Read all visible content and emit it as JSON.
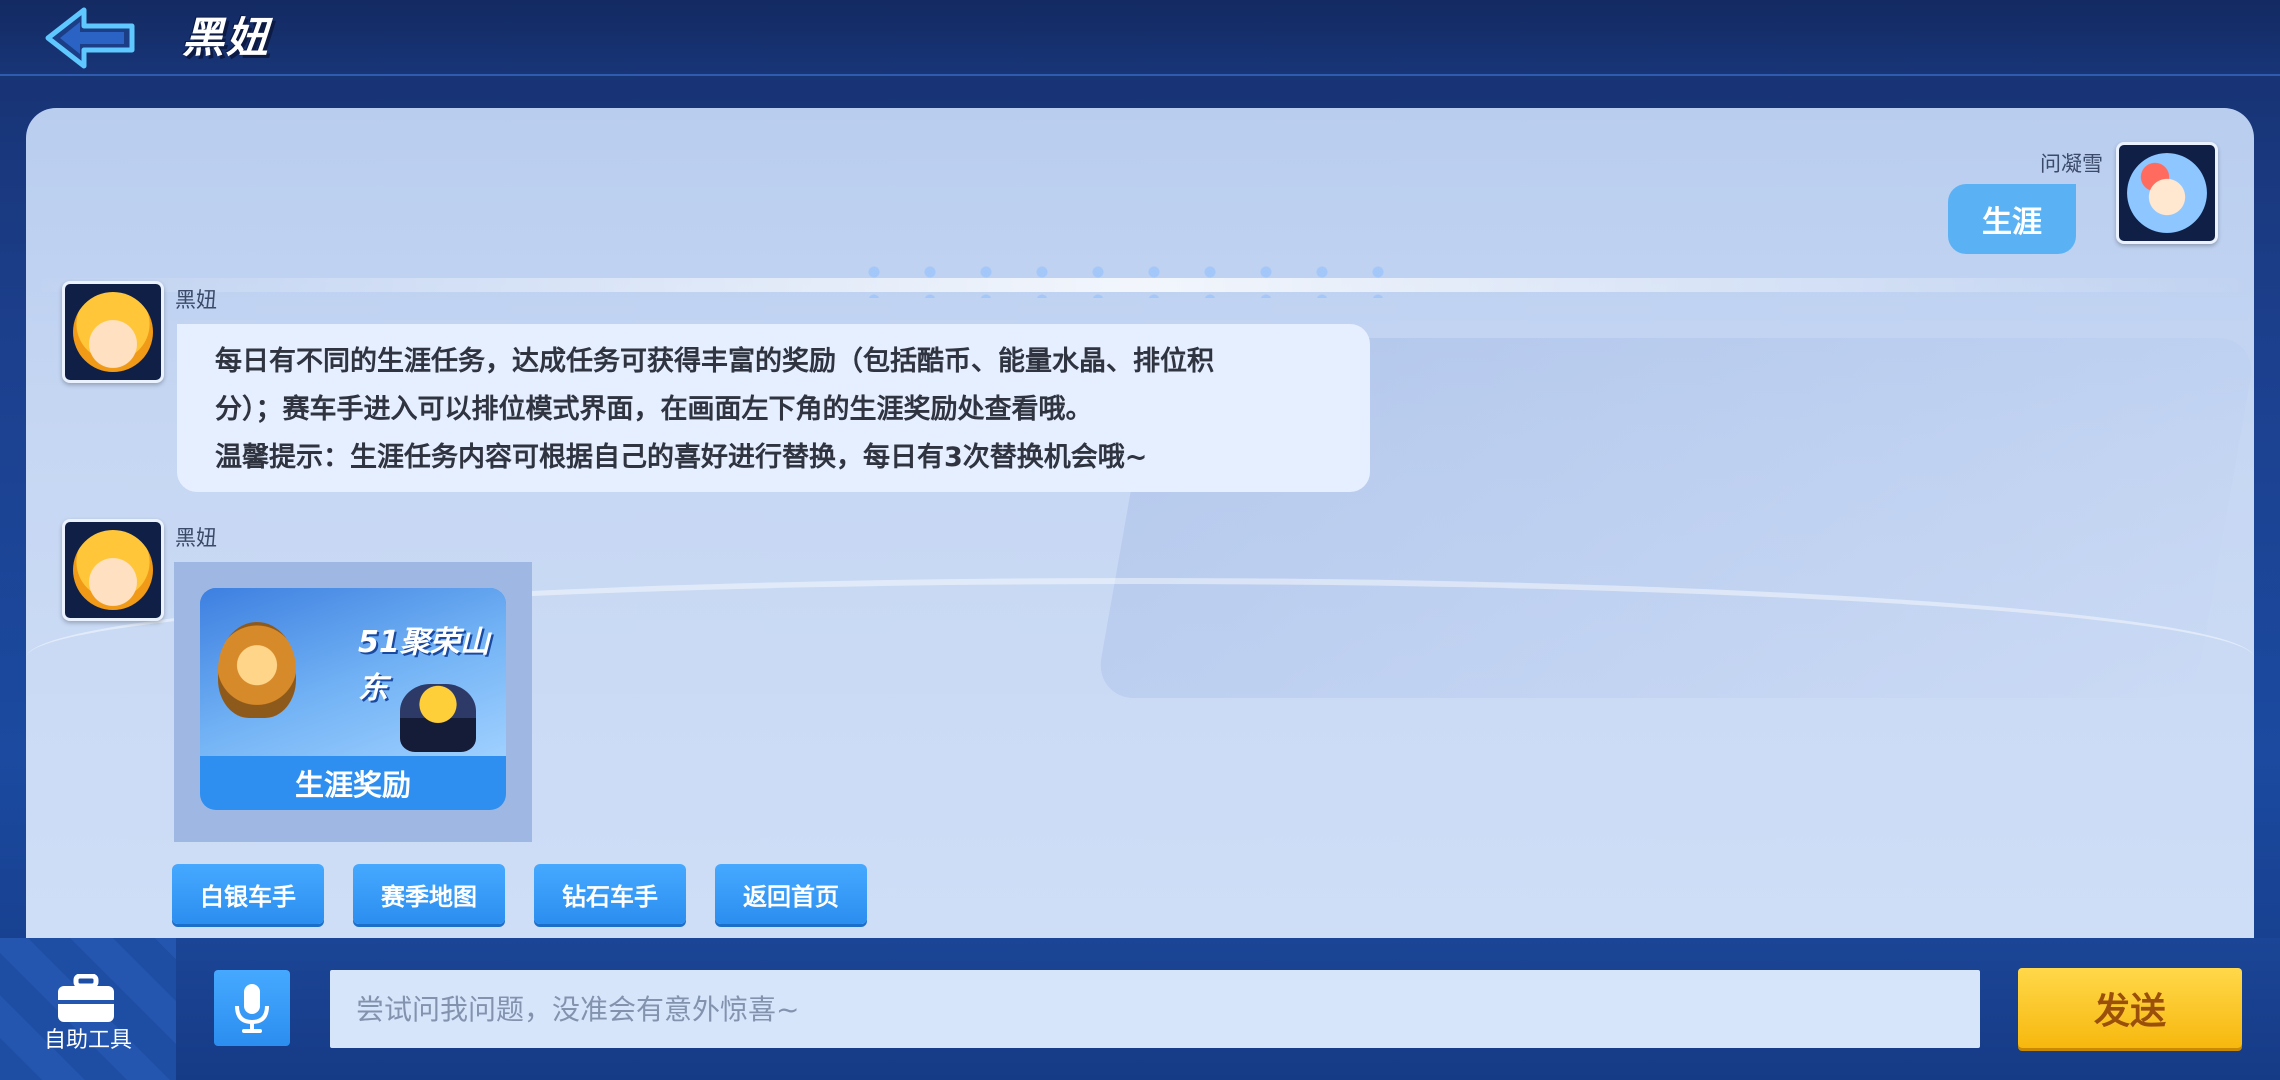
{
  "header": {
    "title": "黑妞",
    "back_icon": "back-arrow-icon"
  },
  "chat": {
    "user_message": {
      "sender": "问凝雪",
      "text": "生涯"
    },
    "bot_text_message": {
      "sender": "黑妞",
      "lines": [
        "每日有不同的生涯任务，达成任务可获得丰富的奖励（包括酷币、能量水晶、排位积",
        "分）；赛车手进入可以排位模式界面，在画面左下角的生涯奖励处查看哦。",
        "温馨提示：生涯任务内容可根据自己的喜好进行替换，每日有3次替换机会哦~"
      ]
    },
    "bot_card_message": {
      "sender": "黑妞",
      "card_caption": "生涯奖励",
      "card_banner_text": "51聚荣山东"
    },
    "quick_replies": [
      "白银车手",
      "赛季地图",
      "钻石车手",
      "返回首页"
    ]
  },
  "bottom_bar": {
    "tools_label": "自助工具",
    "tools_icon": "toolbox-icon",
    "mic_icon": "microphone-icon",
    "input_placeholder": "尝试问我问题，没准会有意外惊喜~",
    "send_label": "发送"
  },
  "colors": {
    "accent_blue": "#2b8ef0",
    "user_bubble": "#5ab2f5",
    "send_yellow": "#f7b80e"
  }
}
